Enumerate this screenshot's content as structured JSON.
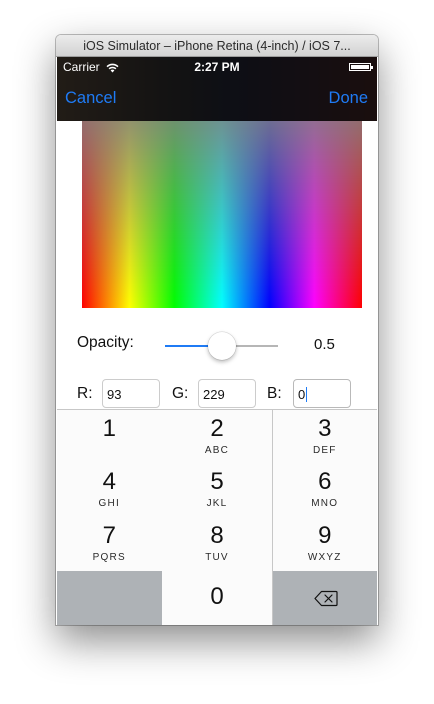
{
  "window": {
    "title": "iOS Simulator – iPhone Retina (4-inch) / iOS 7..."
  },
  "status_bar": {
    "carrier": "Carrier",
    "time": "2:27 PM"
  },
  "nav": {
    "cancel": "Cancel",
    "done": "Done"
  },
  "opacity": {
    "label": "Opacity:",
    "value": "0.5",
    "level": 0.5
  },
  "rgb": {
    "r_label": "R:",
    "r_value": "93",
    "g_label": "G:",
    "g_value": "229",
    "b_label": "B:",
    "b_value": "0"
  },
  "keypad": {
    "keys": [
      {
        "digit": "1",
        "letters": ""
      },
      {
        "digit": "2",
        "letters": "ABC"
      },
      {
        "digit": "3",
        "letters": "DEF"
      },
      {
        "digit": "4",
        "letters": "GHI"
      },
      {
        "digit": "5",
        "letters": "JKL"
      },
      {
        "digit": "6",
        "letters": "MNO"
      },
      {
        "digit": "7",
        "letters": "PQRS"
      },
      {
        "digit": "8",
        "letters": "TUV"
      },
      {
        "digit": "9",
        "letters": "WXYZ"
      },
      {
        "digit": "0",
        "letters": ""
      }
    ],
    "delete_icon": "backspace-icon"
  },
  "colors": {
    "accent": "#1f7bf5"
  }
}
